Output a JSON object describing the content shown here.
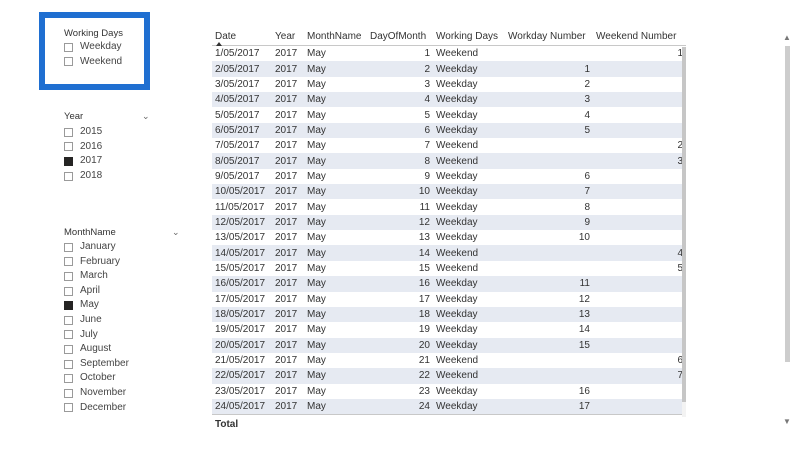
{
  "working_days_slicer": {
    "title": "Working Days",
    "options": [
      {
        "label": "Weekday",
        "checked": false
      },
      {
        "label": "Weekend",
        "checked": false
      }
    ],
    "highlight_color": "#1f6fd1"
  },
  "year_slicer": {
    "title": "Year",
    "options": [
      {
        "label": "2015",
        "checked": false
      },
      {
        "label": "2016",
        "checked": false
      },
      {
        "label": "2017",
        "checked": true
      },
      {
        "label": "2018",
        "checked": false
      }
    ]
  },
  "month_slicer": {
    "title": "MonthName",
    "options": [
      {
        "label": "January",
        "checked": false
      },
      {
        "label": "February",
        "checked": false
      },
      {
        "label": "March",
        "checked": false
      },
      {
        "label": "April",
        "checked": false
      },
      {
        "label": "May",
        "checked": true
      },
      {
        "label": "June",
        "checked": false
      },
      {
        "label": "July",
        "checked": false
      },
      {
        "label": "August",
        "checked": false
      },
      {
        "label": "September",
        "checked": false
      },
      {
        "label": "October",
        "checked": false
      },
      {
        "label": "November",
        "checked": false
      },
      {
        "label": "December",
        "checked": false
      }
    ]
  },
  "table": {
    "columns": [
      "Date",
      "Year",
      "MonthName",
      "DayOfMonth",
      "Working Days",
      "Workday Number",
      "Weekend Number"
    ],
    "rows": [
      [
        "1/05/2017",
        "2017",
        "May",
        "1",
        "Weekend",
        "",
        "1"
      ],
      [
        "2/05/2017",
        "2017",
        "May",
        "2",
        "Weekday",
        "1",
        ""
      ],
      [
        "3/05/2017",
        "2017",
        "May",
        "3",
        "Weekday",
        "2",
        ""
      ],
      [
        "4/05/2017",
        "2017",
        "May",
        "4",
        "Weekday",
        "3",
        ""
      ],
      [
        "5/05/2017",
        "2017",
        "May",
        "5",
        "Weekday",
        "4",
        ""
      ],
      [
        "6/05/2017",
        "2017",
        "May",
        "6",
        "Weekday",
        "5",
        ""
      ],
      [
        "7/05/2017",
        "2017",
        "May",
        "7",
        "Weekend",
        "",
        "2"
      ],
      [
        "8/05/2017",
        "2017",
        "May",
        "8",
        "Weekend",
        "",
        "3"
      ],
      [
        "9/05/2017",
        "2017",
        "May",
        "9",
        "Weekday",
        "6",
        ""
      ],
      [
        "10/05/2017",
        "2017",
        "May",
        "10",
        "Weekday",
        "7",
        ""
      ],
      [
        "11/05/2017",
        "2017",
        "May",
        "11",
        "Weekday",
        "8",
        ""
      ],
      [
        "12/05/2017",
        "2017",
        "May",
        "12",
        "Weekday",
        "9",
        ""
      ],
      [
        "13/05/2017",
        "2017",
        "May",
        "13",
        "Weekday",
        "10",
        ""
      ],
      [
        "14/05/2017",
        "2017",
        "May",
        "14",
        "Weekend",
        "",
        "4"
      ],
      [
        "15/05/2017",
        "2017",
        "May",
        "15",
        "Weekend",
        "",
        "5"
      ],
      [
        "16/05/2017",
        "2017",
        "May",
        "16",
        "Weekday",
        "11",
        ""
      ],
      [
        "17/05/2017",
        "2017",
        "May",
        "17",
        "Weekday",
        "12",
        ""
      ],
      [
        "18/05/2017",
        "2017",
        "May",
        "18",
        "Weekday",
        "13",
        ""
      ],
      [
        "19/05/2017",
        "2017",
        "May",
        "19",
        "Weekday",
        "14",
        ""
      ],
      [
        "20/05/2017",
        "2017",
        "May",
        "20",
        "Weekday",
        "15",
        ""
      ],
      [
        "21/05/2017",
        "2017",
        "May",
        "21",
        "Weekend",
        "",
        "6"
      ],
      [
        "22/05/2017",
        "2017",
        "May",
        "22",
        "Weekend",
        "",
        "7"
      ],
      [
        "23/05/2017",
        "2017",
        "May",
        "23",
        "Weekday",
        "16",
        ""
      ],
      [
        "24/05/2017",
        "2017",
        "May",
        "24",
        "Weekday",
        "17",
        ""
      ]
    ],
    "total_label": "Total",
    "row_alt_color": "#e6eaf2"
  }
}
